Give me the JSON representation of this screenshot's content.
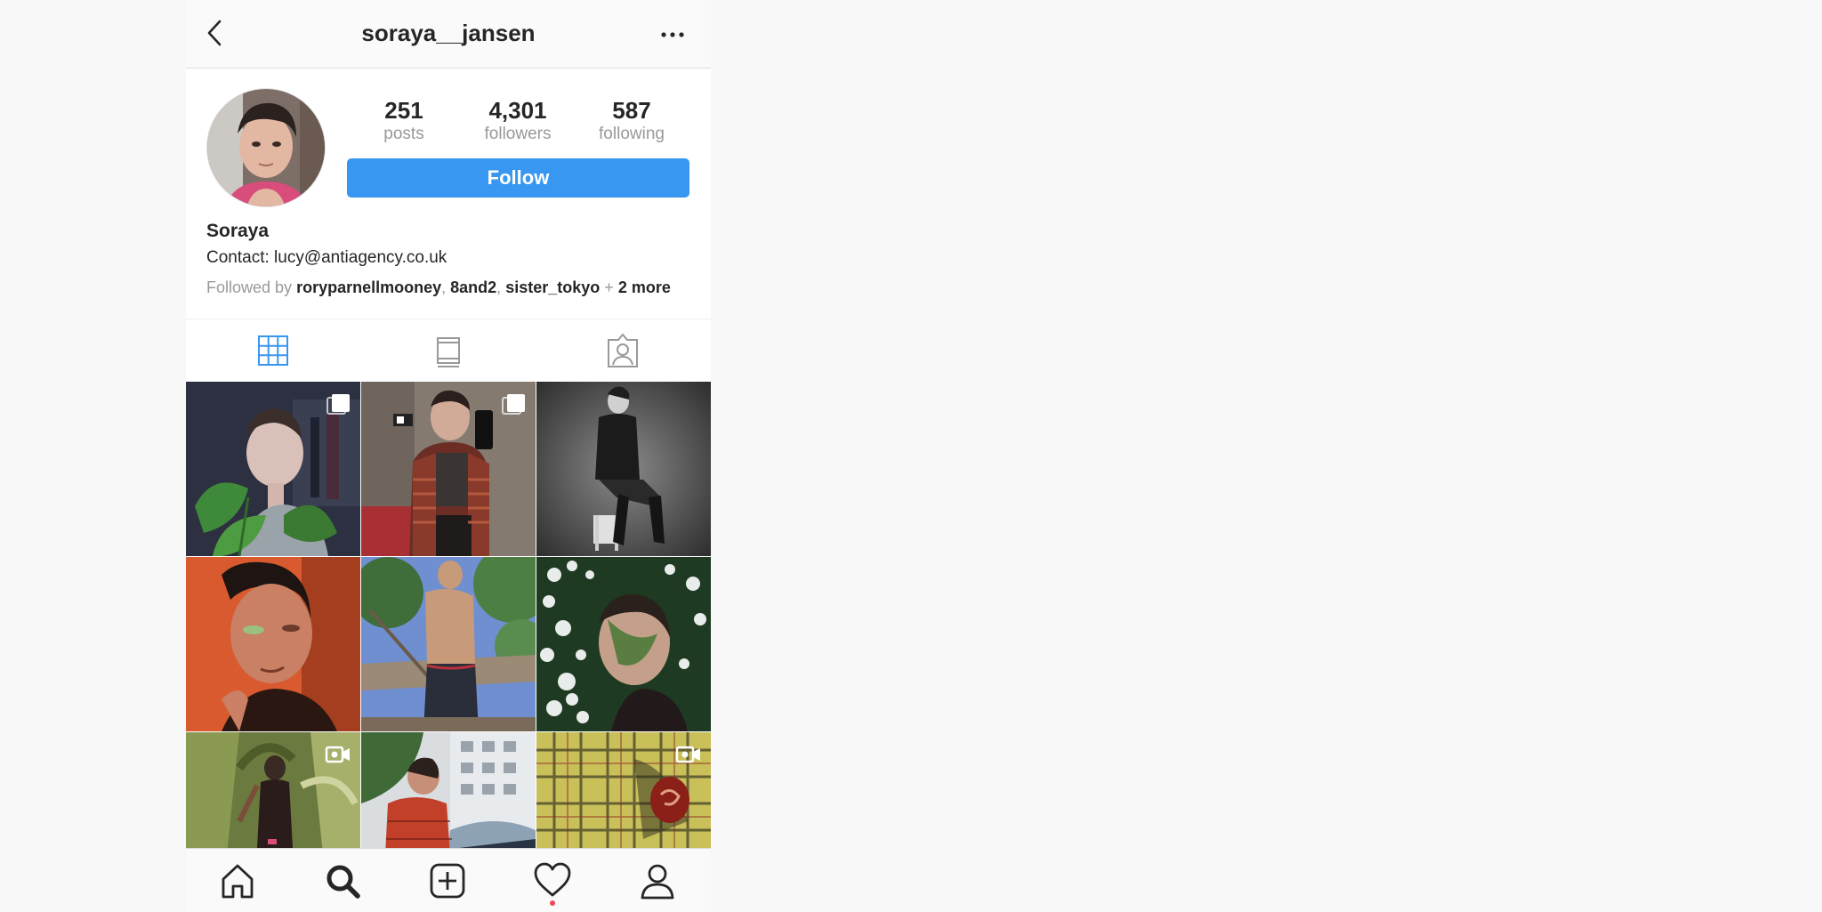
{
  "header": {
    "username": "soraya__jansen",
    "back_icon": "chevron-left-icon",
    "more_icon": "ellipsis-icon"
  },
  "profile": {
    "stats": [
      {
        "count": "251",
        "label": "posts"
      },
      {
        "count": "4,301",
        "label": "followers"
      },
      {
        "count": "587",
        "label": "following"
      }
    ],
    "follow_label": "Follow",
    "name": "Soraya",
    "contact": "Contact: lucy@antiagency.co.uk",
    "followed_by_prefix": "Followed by",
    "followed_by": [
      "roryparnellmooney",
      "8and2",
      "sister_tokyo"
    ],
    "followed_by_sep": ",",
    "followed_by_more_joiner": "+",
    "followed_by_more": "2 more"
  },
  "tabs": [
    {
      "icon": "grid-icon",
      "active": true
    },
    {
      "icon": "feed-icon",
      "active": false
    },
    {
      "icon": "tagged-icon",
      "active": false
    }
  ],
  "posts": [
    {
      "badge": "multiple-photos-icon"
    },
    {
      "badge": "multiple-photos-icon"
    },
    {
      "badge": ""
    },
    {
      "badge": ""
    },
    {
      "badge": ""
    },
    {
      "badge": ""
    },
    {
      "badge": "video-icon"
    },
    {
      "badge": ""
    },
    {
      "badge": "video-icon"
    }
  ],
  "bottom_nav": [
    {
      "icon": "home-icon"
    },
    {
      "icon": "search-icon"
    },
    {
      "icon": "new-post-icon"
    },
    {
      "icon": "activity-heart-icon",
      "notification": true
    },
    {
      "icon": "profile-icon"
    }
  ],
  "colors": {
    "accent": "#3897f0",
    "notification": "#ed4956",
    "muted_text": "#999999",
    "primary_text": "#262626"
  }
}
